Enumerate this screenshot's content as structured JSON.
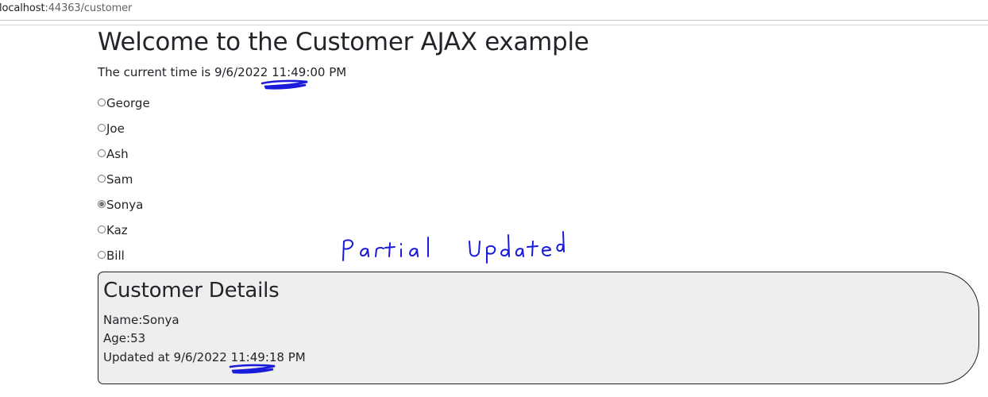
{
  "browser": {
    "url_host": "localhost",
    "url_rest": ":44363/customer"
  },
  "page": {
    "title": "Welcome to the Customer AJAX example",
    "time_prefix": "The current time is ",
    "time_value": "9/6/2022 11:49:00 PM"
  },
  "customers": [
    {
      "label": "George",
      "checked": false
    },
    {
      "label": "Joe",
      "checked": false
    },
    {
      "label": "Ash",
      "checked": false
    },
    {
      "label": "Sam",
      "checked": false
    },
    {
      "label": "Sonya",
      "checked": true
    },
    {
      "label": "Kaz",
      "checked": false
    },
    {
      "label": "Bill",
      "checked": false
    }
  ],
  "details": {
    "heading": "Customer Details",
    "name_row": "Name:Sonya",
    "age_row": "Age:53",
    "updated_row": "Updated at 9/6/2022 11:49:18 PM"
  },
  "annotation": {
    "handwritten_text": "Partial Updated",
    "ink_color": "#1a1adc"
  }
}
